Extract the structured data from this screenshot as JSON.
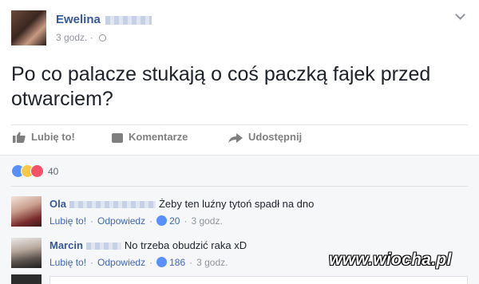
{
  "post": {
    "author_first_name": "Ewelina",
    "time": "3 godz.",
    "text": "Po co palacze stukają o coś paczką fajek przed otwarciem?"
  },
  "actions": {
    "like_label": "Lubię to!",
    "comment_label": "Komentarze",
    "share_label": "Udostępnij"
  },
  "reactions": {
    "count": "40",
    "icons": [
      "like-icon",
      "haha-icon",
      "love-icon"
    ]
  },
  "comments": [
    {
      "name": "Ola",
      "text": "Żeby ten luźny tytoń spadł na dno",
      "like_label": "Lubię to!",
      "reply_label": "Odpowiedz",
      "reaction_count": "20",
      "time": "3 godz."
    },
    {
      "name": "Marcin",
      "text": "No trzeba obudzić raka xD",
      "like_label": "Lubię to!",
      "reply_label": "Odpowiedz",
      "reaction_count": "186",
      "time": "3 godz."
    }
  ],
  "watermark": "www.wiocha.pl",
  "colors": {
    "link": "#365899",
    "like": "#5890ff",
    "haha": "#f7c948",
    "love": "#f25268",
    "muted": "#90949c"
  }
}
